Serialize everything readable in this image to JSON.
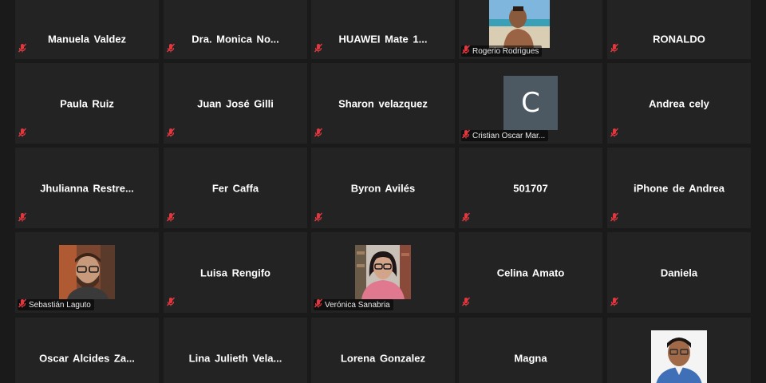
{
  "participants": [
    {
      "name": "Manuela Valdez",
      "muted": true
    },
    {
      "name": "Dra.  Monica  No...",
      "muted": true
    },
    {
      "name": "HUAWEI  Mate  1...",
      "muted": true
    },
    {
      "name": "Rogerio Rodrigues",
      "muted": true,
      "video": "beach-selfie"
    },
    {
      "name": "RONALDO",
      "muted": true
    },
    {
      "name": "Paula Ruiz",
      "muted": true
    },
    {
      "name": "Juan José Gilli",
      "muted": true
    },
    {
      "name": "Sharon velazquez",
      "muted": true
    },
    {
      "name": "Cristian Oscar Mar...",
      "muted": true,
      "avatar_letter": "C",
      "avatar_color": "#4c5862"
    },
    {
      "name": "Andrea cely",
      "muted": true
    },
    {
      "name": "Jhulianna  Restre...",
      "muted": true
    },
    {
      "name": "Fer Caffa",
      "muted": true
    },
    {
      "name": "Byron Avilés",
      "muted": true
    },
    {
      "name": "501707",
      "muted": true
    },
    {
      "name": "iPhone de Andrea",
      "muted": true
    },
    {
      "name": "Sebastián Laguto",
      "muted": true,
      "video": "man-glasses-beard"
    },
    {
      "name": "Luisa Rengifo",
      "muted": true
    },
    {
      "name": "Verónica Sanabria",
      "muted": true,
      "video": "woman-glasses-bookshelf"
    },
    {
      "name": "Celina Amato",
      "muted": true
    },
    {
      "name": "Daniela",
      "muted": true
    },
    {
      "name": "Oscar  Alcides  Za...",
      "muted": true
    },
    {
      "name": "Lina  Julieth  Vela...",
      "muted": true
    },
    {
      "name": "Lorena Gonzalez",
      "muted": true
    },
    {
      "name": "Magna",
      "muted": true
    },
    {
      "name": "",
      "muted": false,
      "video": "man-portrait-white-bg"
    }
  ],
  "colors": {
    "background": "#1a1a1a",
    "tile": "#232323",
    "mute_icon": "#e0383e"
  },
  "icons": {
    "muted": "microphone-muted-icon"
  }
}
